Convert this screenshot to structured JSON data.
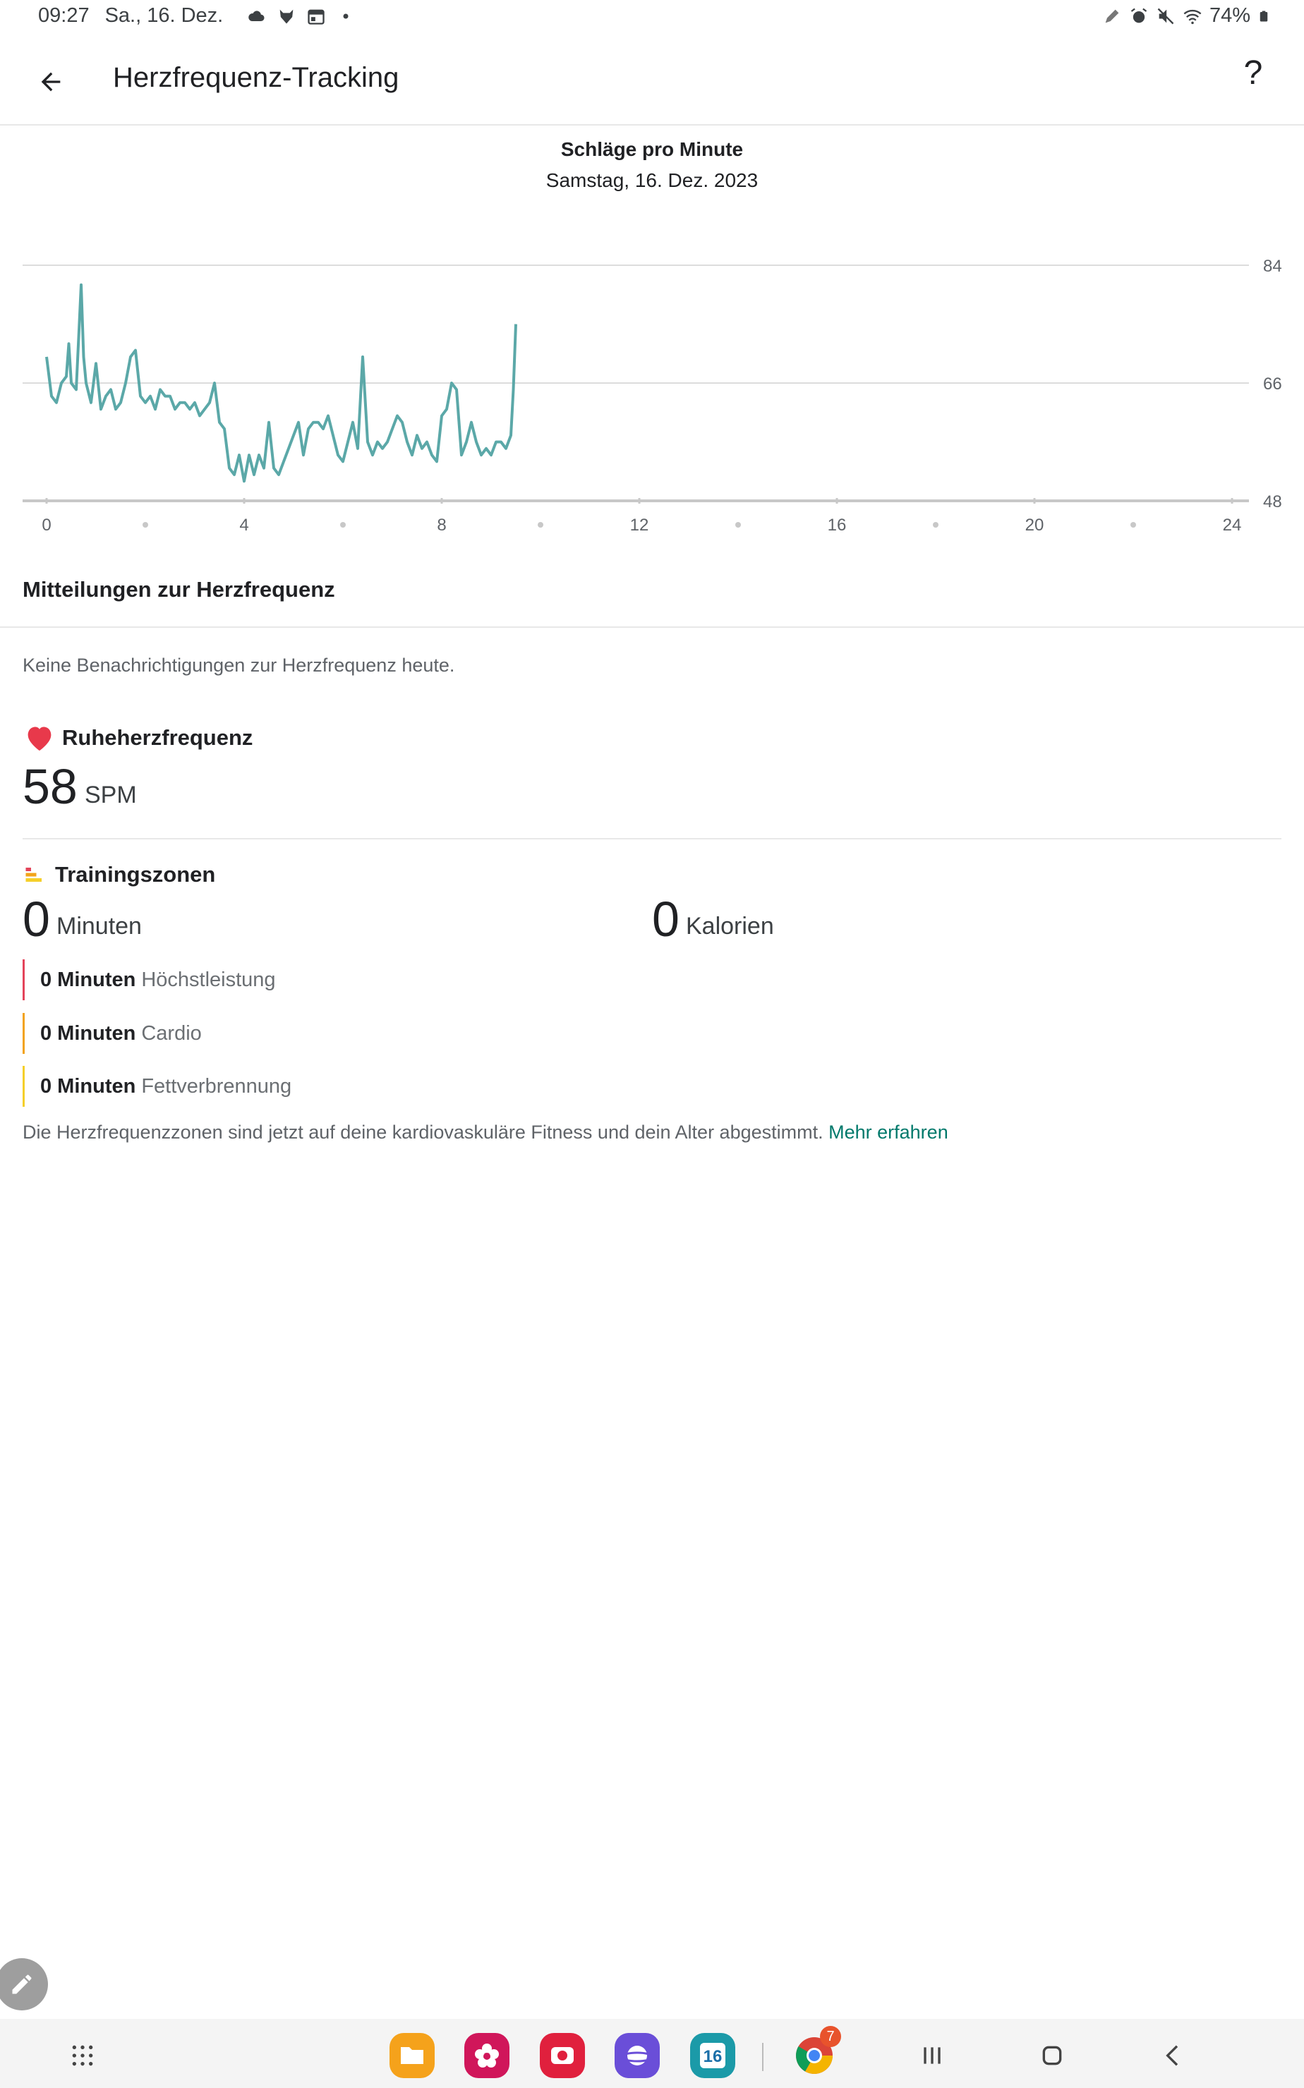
{
  "status_bar": {
    "time": "09:27",
    "date": "Sa., 16. Dez.",
    "battery": "74%",
    "left_icons": [
      "cloud-icon",
      "fox-icon",
      "calendar-icon",
      "dot-icon"
    ],
    "right_icons": [
      "pen-icon",
      "alarm-icon",
      "mute-icon",
      "wifi-icon",
      "battery-icon"
    ]
  },
  "app_bar": {
    "title": "Herzfrequenz-Tracking",
    "help_label": "?"
  },
  "chart_data": {
    "type": "line",
    "title": "Schläge pro Minute",
    "subtitle": "Samstag, 16. Dez. 2023",
    "x_ticks": [
      "0",
      "4",
      "8",
      "12",
      "16",
      "20",
      "24"
    ],
    "y_ticks": [
      "84",
      "66",
      "48"
    ],
    "xlim": [
      0,
      24
    ],
    "ylim": [
      48,
      84
    ],
    "grid": true,
    "color": "#5ba8a8",
    "x": [
      0.0,
      0.1,
      0.2,
      0.3,
      0.4,
      0.45,
      0.5,
      0.6,
      0.7,
      0.75,
      0.8,
      0.9,
      1.0,
      1.1,
      1.2,
      1.3,
      1.4,
      1.5,
      1.6,
      1.7,
      1.8,
      1.9,
      2.0,
      2.1,
      2.2,
      2.3,
      2.4,
      2.5,
      2.6,
      2.7,
      2.8,
      2.9,
      3.0,
      3.1,
      3.2,
      3.3,
      3.4,
      3.5,
      3.6,
      3.7,
      3.8,
      3.9,
      4.0,
      4.1,
      4.2,
      4.3,
      4.4,
      4.5,
      4.6,
      4.7,
      4.8,
      4.9,
      5.0,
      5.1,
      5.2,
      5.3,
      5.4,
      5.5,
      5.6,
      5.7,
      5.8,
      5.9,
      6.0,
      6.1,
      6.2,
      6.3,
      6.4,
      6.5,
      6.6,
      6.7,
      6.8,
      6.9,
      7.0,
      7.1,
      7.2,
      7.3,
      7.4,
      7.5,
      7.6,
      7.7,
      7.8,
      7.9,
      8.0,
      8.1,
      8.2,
      8.3,
      8.4,
      8.5,
      8.6,
      8.7,
      8.8,
      8.9,
      9.0,
      9.1,
      9.2,
      9.3,
      9.4,
      9.45,
      9.5
    ],
    "y": [
      70,
      64,
      63,
      66,
      67,
      72,
      66,
      65,
      81,
      70,
      66,
      63,
      69,
      62,
      64,
      65,
      62,
      63,
      66,
      70,
      71,
      64,
      63,
      64,
      62,
      65,
      64,
      64,
      62,
      63,
      63,
      62,
      63,
      61,
      62,
      63,
      66,
      60,
      59,
      53,
      52,
      55,
      51,
      55,
      52,
      55,
      53,
      60,
      53,
      52,
      54,
      56,
      58,
      60,
      55,
      59,
      60,
      60,
      59,
      61,
      58,
      55,
      54,
      57,
      60,
      56,
      70,
      57,
      55,
      57,
      56,
      57,
      59,
      61,
      60,
      57,
      55,
      58,
      56,
      57,
      55,
      54,
      61,
      62,
      66,
      65,
      55,
      57,
      60,
      57,
      55,
      56,
      55,
      57,
      57,
      56,
      58,
      65,
      75
    ]
  },
  "notifications": {
    "title": "Mitteilungen zur Herzfrequenz",
    "empty_text": "Keine Benachrichtigungen zur Herzfrequenz heute."
  },
  "resting_hr": {
    "label": "Ruheherzfrequenz",
    "value": "58",
    "unit": "SPM",
    "heart_color": "#e8394b"
  },
  "training_zones": {
    "title": "Trainingszonen",
    "minutes_value": "0",
    "minutes_unit": "Minuten",
    "calories_value": "0",
    "calories_unit": "Kalorien",
    "zones": [
      {
        "amount": "0 Minuten",
        "name": "Höchstleistung",
        "color": "#e3445a"
      },
      {
        "amount": "0 Minuten",
        "name": "Cardio",
        "color": "#f2a31b"
      },
      {
        "amount": "0 Minuten",
        "name": "Fettverbrennung",
        "color": "#f5cf2a"
      }
    ],
    "footer": "Die Herzfrequenzzonen sind jetzt auf deine kardiovaskuläre Fitness und dein Alter abgestimmt.",
    "footer_link": "Mehr erfahren"
  },
  "dock": {
    "apps": [
      "apps-grid-icon",
      "files-icon",
      "flower-gallery-icon",
      "camera-icon",
      "internet-icon",
      "calendar-app-icon",
      "chrome-icon"
    ],
    "calendar_day": "16",
    "chrome_badge": "7"
  }
}
